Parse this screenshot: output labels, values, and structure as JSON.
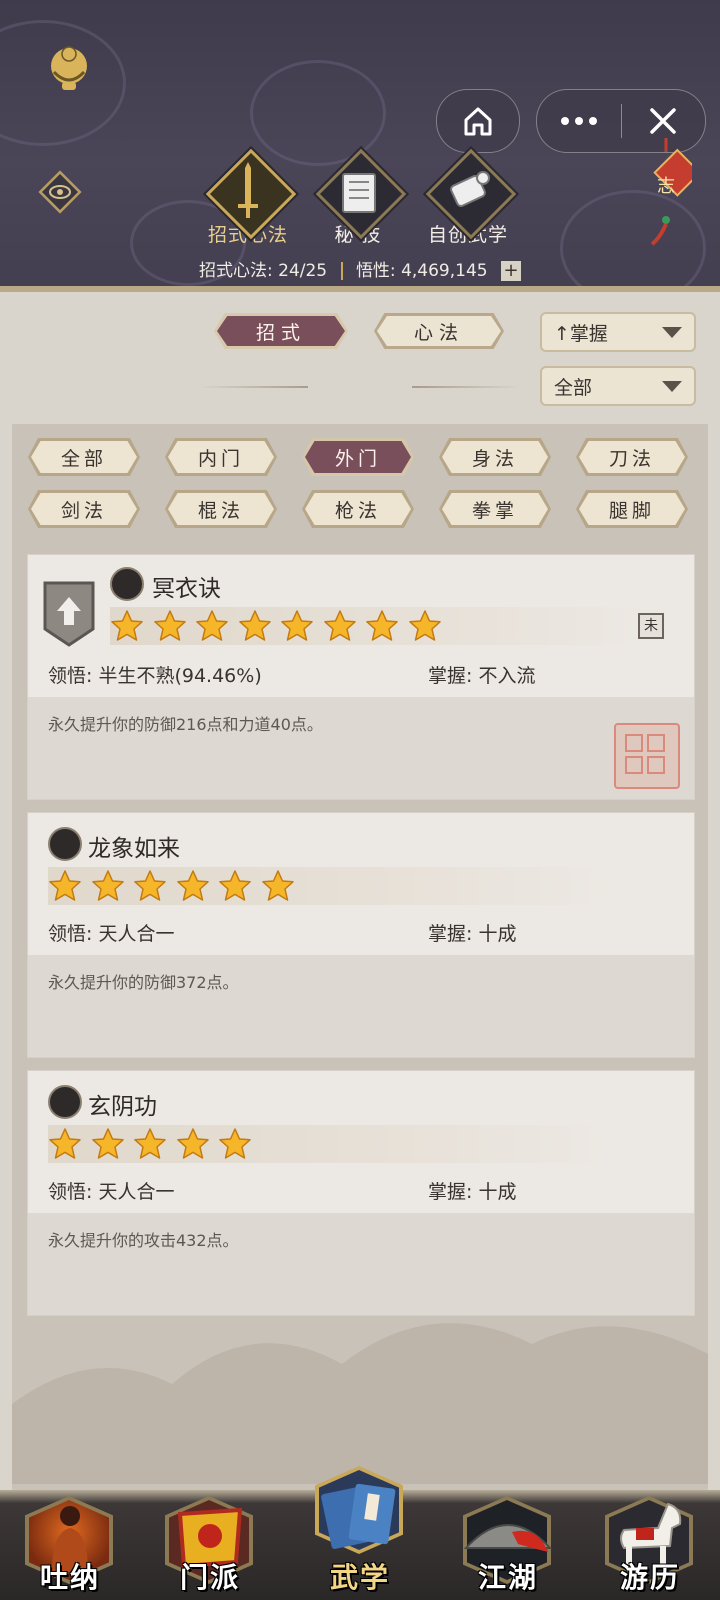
{
  "header": {
    "tabs": [
      {
        "label": "招式心法",
        "icon": "sword-icon",
        "active": true
      },
      {
        "label": "秘 技",
        "icon": "book-icon",
        "active": false
      },
      {
        "label": "自创武学",
        "icon": "scroll-icon",
        "active": false
      }
    ],
    "stats": {
      "moves_label": "招式心法:",
      "moves_value": "24/25",
      "insight_label": "悟性:",
      "insight_value": "4,469,145"
    },
    "knot_char": "志"
  },
  "controls": {
    "type_tabs": [
      "招式",
      "心法"
    ],
    "active_type": "招式",
    "sort_select": "↑掌握",
    "filter_select": "全部"
  },
  "filters": {
    "row1": [
      "全部",
      "内门",
      "外门",
      "身法",
      "刀法"
    ],
    "row2": [
      "剑法",
      "棍法",
      "枪法",
      "拳掌",
      "腿脚"
    ],
    "active": "外门"
  },
  "cards": [
    {
      "name": "冥衣诀",
      "stars": 8,
      "comprehension_label": "领悟:",
      "comprehension_value": "半生不熟(94.46%)",
      "mastery_label": "掌握:",
      "mastery_value": "不入流",
      "description": "永久提升你的防御216点和力道40点。",
      "seal_text": "詞林 辟真",
      "rank_box": "未"
    },
    {
      "name": "龙象如来",
      "stars": 6,
      "comprehension_label": "领悟:",
      "comprehension_value": "天人合一",
      "mastery_label": "掌握:",
      "mastery_value": "十成",
      "description": "永久提升你的防御372点。"
    },
    {
      "name": "玄阴功",
      "stars": 5,
      "comprehension_label": "领悟:",
      "comprehension_value": "天人合一",
      "mastery_label": "掌握:",
      "mastery_value": "十成",
      "description": "永久提升你的攻击432点。"
    }
  ],
  "bottom_nav": [
    {
      "label": "吐纳",
      "icon": "monk-icon",
      "active": false
    },
    {
      "label": "门派",
      "icon": "banner-icon",
      "active": false
    },
    {
      "label": "武学",
      "icon": "manual-icon",
      "active": true
    },
    {
      "label": "江湖",
      "icon": "hat-icon",
      "active": false
    },
    {
      "label": "游历",
      "icon": "horse-icon",
      "active": false
    }
  ],
  "colors": {
    "header_bg": "#45414f",
    "accent_gold": "#c9a85a",
    "active_tab": "#7a4f5c",
    "panel_bg": "#c9c2b8",
    "card_bg": "#ece8e3"
  }
}
